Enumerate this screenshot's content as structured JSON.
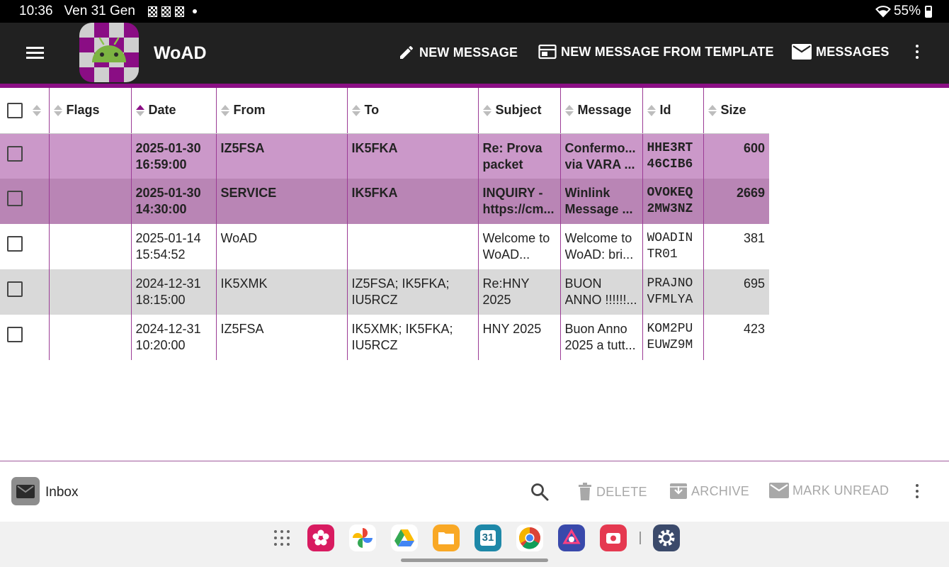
{
  "status_bar": {
    "time": "10:36",
    "date": "Ven 31 Gen",
    "battery": "55%"
  },
  "app_bar": {
    "title": "WoAD",
    "actions": {
      "new_message": "NEW MESSAGE",
      "new_from_template": "NEW MESSAGE FROM TEMPLATE",
      "messages": "MESSAGES"
    }
  },
  "table": {
    "columns": {
      "flags": "Flags",
      "date": "Date",
      "from": "From",
      "to": "To",
      "subject": "Subject",
      "message": "Message",
      "id": "Id",
      "size": "Size"
    },
    "sort_column": "Date",
    "rows": [
      {
        "date1": "2025-01-30",
        "date2": "16:59:00",
        "from": "IZ5FSA",
        "to1": "IK5FKA",
        "to2": "",
        "subject1": "Re: Prova",
        "subject2": "packet",
        "message1": "Confermo...",
        "message2": "via VARA ...",
        "id1": "HHE3RT",
        "id2": "46CIB6",
        "size": "600",
        "unread": true
      },
      {
        "date1": "2025-01-30",
        "date2": "14:30:00",
        "from": "SERVICE",
        "to1": "IK5FKA",
        "to2": "",
        "subject1": "INQUIRY -",
        "subject2": "https://cm...",
        "message1": "Winlink",
        "message2": "Message ...",
        "id1": "OVOKEQ",
        "id2": "2MW3NZ",
        "size": "2669",
        "unread": true
      },
      {
        "date1": "2025-01-14",
        "date2": "15:54:52",
        "from": "WoAD",
        "to1": "",
        "to2": "",
        "subject1": "Welcome to",
        "subject2": "WoAD...",
        "message1": "Welcome to",
        "message2": "WoAD: bri...",
        "id1": "WOADIN",
        "id2": "TR01",
        "size": "381",
        "unread": false
      },
      {
        "date1": "2024-12-31",
        "date2": "18:15:00",
        "from": "IK5XMK",
        "to1": "IZ5FSA; IK5FKA;",
        "to2": "IU5RCZ",
        "subject1": "Re:HNY",
        "subject2": "2025",
        "message1": "BUON",
        "message2": "ANNO !!!!!!...",
        "id1": "PRAJNO",
        "id2": "VFMLYA",
        "size": "695",
        "unread": false
      },
      {
        "date1": "2024-12-31",
        "date2": "10:20:00",
        "from": "IZ5FSA",
        "to1": "IK5XMK; IK5FKA;",
        "to2": "IU5RCZ",
        "subject1": "HNY 2025",
        "subject2": "",
        "message1": "Buon Anno",
        "message2": "2025 a tutt...",
        "id1": "KOM2PU",
        "id2": "EUWZ9M",
        "size": "423",
        "unread": false
      }
    ]
  },
  "bottom_bar": {
    "folder": "Inbox",
    "actions": {
      "delete": "DELETE",
      "archive": "ARCHIVE",
      "mark_unread": "MARK UNREAD"
    }
  },
  "dock": {
    "apps": [
      "app-drawer",
      "gallery",
      "photos",
      "drive",
      "files",
      "calendar",
      "chrome",
      "app-store",
      "screen-recorder",
      "settings"
    ],
    "calendar_day": "31"
  },
  "colors": {
    "accent": "#8b0f85",
    "unread_row_1": "#cb98c9",
    "unread_row_2": "#b985b5",
    "alt_row": "#d9d9d9",
    "app_bar": "#212121"
  }
}
